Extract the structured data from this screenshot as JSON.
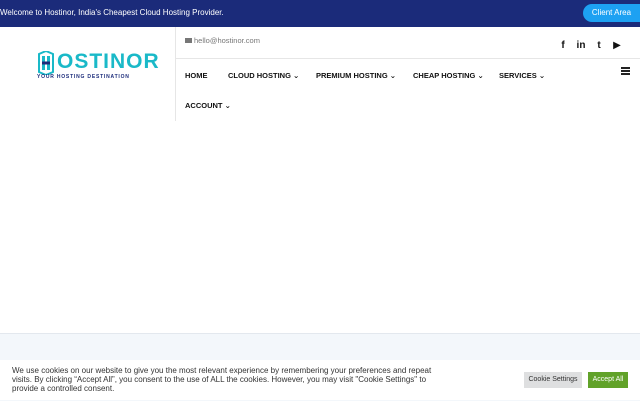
{
  "topbar": {
    "welcome": "Welcome to Hostinor, India's Cheapest Cloud Hosting Provider.",
    "client_area": "Client Area"
  },
  "logo": {
    "brand": "OSTINOR",
    "tagline": "YOUR HOSTING DESTINATION"
  },
  "contact": {
    "email": "hello@hostinor.com"
  },
  "social": [
    "facebook-icon",
    "linkedin-icon",
    "twitter-icon",
    "youtube-icon"
  ],
  "nav": {
    "home": "HOME",
    "cloud": "CLOUD HOSTING",
    "premium": "PREMIUM HOSTING",
    "cheap": "CHEAP HOSTING",
    "services": "SERVICES",
    "account": "ACCOUNT"
  },
  "cookie": {
    "message": "We use cookies on our website to give you the most relevant experience by remembering your preferences and repeat visits. By clicking “Accept All”, you consent to the use of ALL the cookies. However, you may visit \"Cookie Settings\" to provide a controlled consent.",
    "settings": "Cookie Settings",
    "accept": "Accept All"
  },
  "colors": {
    "topbar": "#1b2b7a",
    "accent": "#1da1f2",
    "brand": "#1ab9c8",
    "accept": "#61a229"
  }
}
